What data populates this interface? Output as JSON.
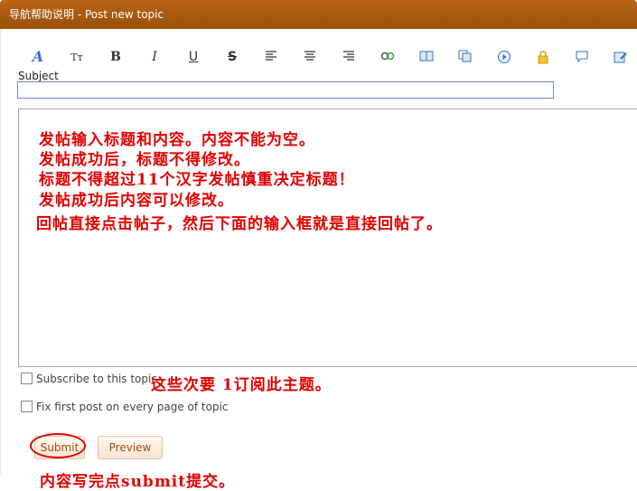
{
  "window": {
    "title": "导航帮助说明 - Post new topic"
  },
  "toolbar": {
    "buttons": [
      {
        "name": "font-style-icon",
        "glyph": "A"
      },
      {
        "name": "font-size-icon",
        "glyph": "Tт"
      },
      {
        "name": "bold-icon",
        "glyph": "B"
      },
      {
        "name": "italic-icon",
        "glyph": "I"
      },
      {
        "name": "underline-icon",
        "glyph": "U"
      },
      {
        "name": "strikethrough-icon",
        "glyph": "S"
      },
      {
        "name": "align-left-icon",
        "glyph": "≡"
      },
      {
        "name": "align-center-icon",
        "glyph": "≡"
      },
      {
        "name": "align-right-icon",
        "glyph": "≡"
      },
      {
        "name": "link-icon",
        "glyph": "∞"
      },
      {
        "name": "book-icon",
        "glyph": "▭"
      },
      {
        "name": "copy-icon",
        "glyph": "❐"
      },
      {
        "name": "media-play-icon",
        "glyph": "▶"
      },
      {
        "name": "lock-icon",
        "glyph": "🔒"
      },
      {
        "name": "comment-icon",
        "glyph": "💬"
      },
      {
        "name": "edit-icon",
        "glyph": "✎"
      }
    ]
  },
  "form": {
    "subject_label": "Subject",
    "subject_value": "",
    "notes": [
      "发帖输入标题和内容。内容不能为空。",
      "发帖成功后，标题不得修改。",
      "标题不得超过11个汉字发帖慎重决定标题！",
      "发帖成功后内容可以修改。",
      "回帖直接点击帖子，然后下面的输入框就是直接回帖了。"
    ],
    "subscribe_label": "Subscribe to this topic",
    "subscribe_note": "这些次要  1订阅此主题。",
    "fix_first_label": "Fix first post on every page of topic",
    "submit_label": "Submit",
    "preview_label": "Preview",
    "submit_note": "内容写完点submit提交。"
  },
  "colors": {
    "titlebar": "#b86516",
    "annotation": "#e00000"
  }
}
